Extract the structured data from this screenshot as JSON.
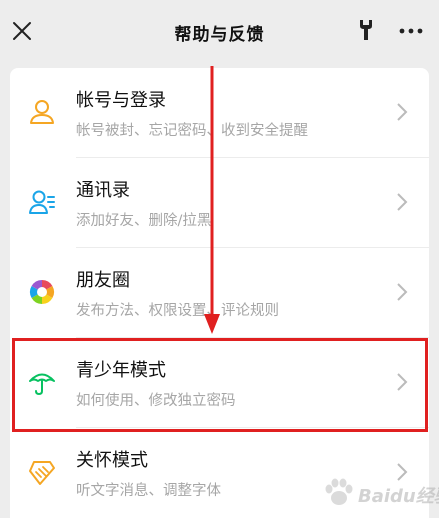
{
  "header": {
    "title": "帮助与反馈"
  },
  "items": [
    {
      "label": "帐号与登录",
      "sub": "帐号被封、忘记密码、收到安全提醒",
      "icon": "user-icon",
      "color": "#f5a623"
    },
    {
      "label": "通讯录",
      "sub": "添加好友、删除/拉黑",
      "icon": "contacts-icon",
      "color": "#1aa5e8"
    },
    {
      "label": "朋友圈",
      "sub": "发布方法、权限设置、评论规则",
      "icon": "moments-icon",
      "color": "#e84b5c"
    },
    {
      "label": "青少年模式",
      "sub": "如何使用、修改独立密码",
      "icon": "umbrella-icon",
      "color": "#07c160"
    },
    {
      "label": "关怀模式",
      "sub": "听文字消息、调整字体",
      "icon": "care-icon",
      "color": "#f5a623"
    }
  ],
  "annotation": {
    "highlight_color": "#e02020",
    "highlighted_item": "青少年模式"
  },
  "watermark": {
    "text": "Baidu经验"
  }
}
